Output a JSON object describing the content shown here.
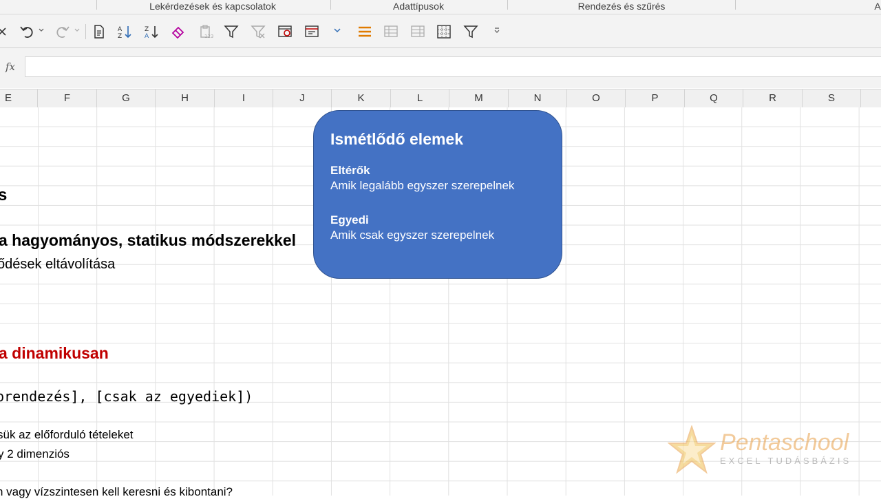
{
  "ribbon": {
    "groups": [
      {
        "label": "Lekérdezések és kapcsolatok"
      },
      {
        "label": "Adattípusok"
      },
      {
        "label": "Rendezés és szűrés"
      },
      {
        "label": "A"
      }
    ]
  },
  "toolbar": {
    "icons": [
      "close-icon",
      "undo-icon",
      "redo-icon",
      "document-properties-icon",
      "sort-ascending-icon",
      "sort-descending-icon",
      "eraser-icon",
      "paste-values-icon",
      "filter-icon",
      "clear-filter-icon",
      "form-icon",
      "toggle-icon",
      "more-chevron-icon",
      "group-lines-icon",
      "table-icon-1",
      "table-icon-2",
      "grid-icon",
      "filter-icon-2",
      "customize-toolbar-icon"
    ]
  },
  "formula_bar": {
    "fx_label": "fx",
    "value": ""
  },
  "columns": [
    "E",
    "F",
    "G",
    "H",
    "I",
    "J",
    "K",
    "L",
    "M",
    "N",
    "O",
    "P",
    "Q",
    "R",
    "S"
  ],
  "cells": {
    "row3": "s",
    "row5": "a hagyományos, statikus módszerekkel",
    "row6": "ődések eltávolítása",
    "row10": "a dinamikusan",
    "row12": "prendezés], [csak az egyediek])",
    "row14": "sük az előforduló tételeket",
    "row15": "y 2 dimenziós",
    "row17": "n vagy vízszintesen kell keresni és kibontani?"
  },
  "callout": {
    "title": "Ismétlődő elemek",
    "section1_title": "Eltérők",
    "section1_text": "Amik legalább egyszer szerepelnek",
    "section2_title": "Egyedi",
    "section2_text": "Amik csak egyszer szerepelnek",
    "fill_color": "#4472c4"
  },
  "logo": {
    "name": "Pentaschool",
    "tagline": "EXCEL TUDÁSBÁZIS",
    "color": "#e8a048"
  }
}
